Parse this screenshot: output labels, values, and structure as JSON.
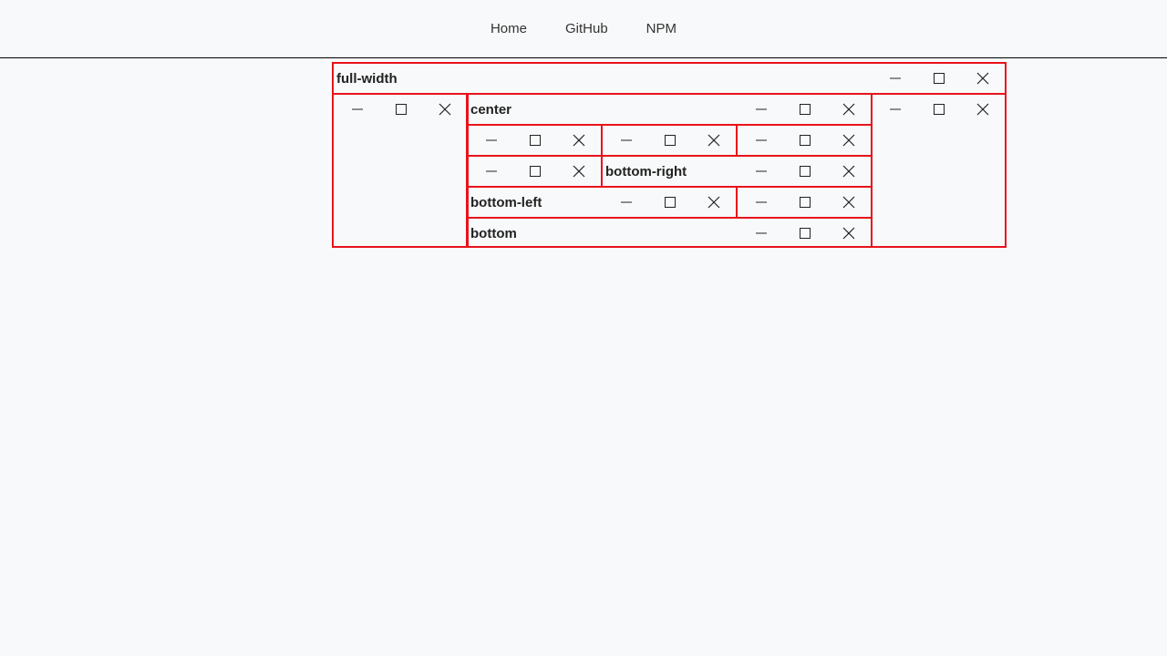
{
  "nav": {
    "links": [
      "Home",
      "GitHub",
      "NPM"
    ]
  },
  "colors": {
    "panel_border": "#e8131b",
    "background": "#f8f9fa"
  },
  "icons": {
    "minimize": "minimize-icon",
    "maximize": "maximize-icon",
    "close": "close-icon"
  },
  "panels": {
    "full_width": {
      "title": "full-width"
    },
    "left": {
      "title": ""
    },
    "center": {
      "title": "center"
    },
    "right": {
      "title": ""
    },
    "row2_left": {
      "title": ""
    },
    "row2_mid": {
      "title": ""
    },
    "row2_right": {
      "title": ""
    },
    "row3_left": {
      "title": ""
    },
    "bottom_right": {
      "title": "bottom-right"
    },
    "bottom_left": {
      "title": "bottom-left"
    },
    "row4_right": {
      "title": ""
    },
    "bottom": {
      "title": "bottom"
    }
  }
}
